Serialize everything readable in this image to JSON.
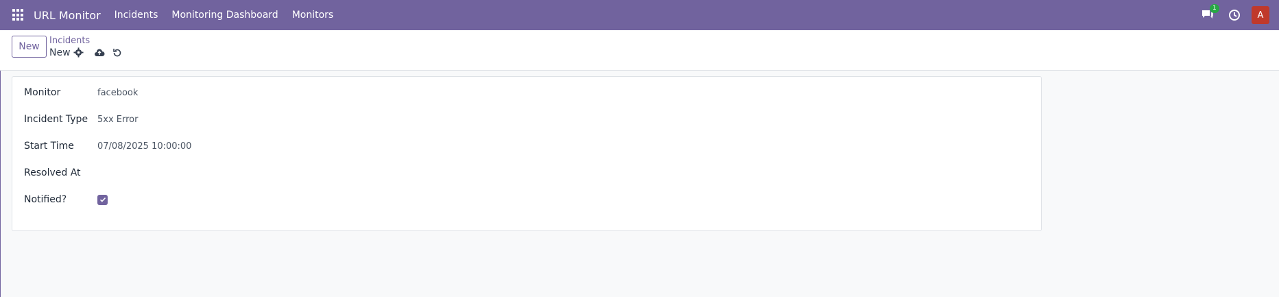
{
  "navbar": {
    "brand": "URL Monitor",
    "menu": [
      "Incidents",
      "Monitoring Dashboard",
      "Monitors"
    ],
    "chat_badge": "1",
    "avatar_letter": "A",
    "icons": [
      "apps-grid-icon",
      "chat-icon",
      "clock-icon"
    ]
  },
  "control_panel": {
    "new_label": "New",
    "breadcrumb": "Incidents",
    "record_title": "New",
    "icons": [
      "gear-icon",
      "cloud-upload-icon",
      "discard-icon"
    ]
  },
  "form": {
    "fields": [
      {
        "label": "Monitor",
        "value": "facebook"
      },
      {
        "label": "Incident Type",
        "value": "5xx Error"
      },
      {
        "label": "Start Time",
        "value": "07/08/2025 10:00:00"
      },
      {
        "label": "Resolved At",
        "value": ""
      },
      {
        "label": "Notified?",
        "value": ""
      }
    ],
    "notified_checked": true
  },
  "colors": {
    "brand": "#71639e",
    "badge": "#28a745",
    "avatar": "#c0392b"
  }
}
